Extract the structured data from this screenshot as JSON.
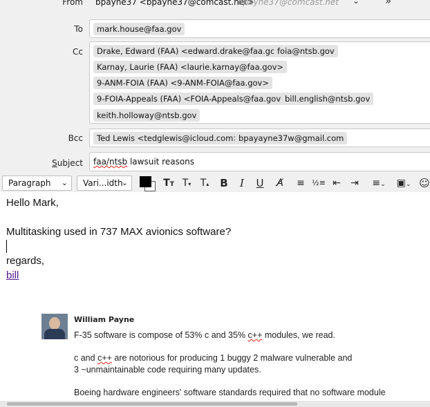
{
  "header": {
    "from_label": "From",
    "from_value": "bpayne37 <bpayne37@comcast.net>",
    "from_hint": "bpayne37@comcast.net",
    "to_label": "To",
    "to": [
      "mark.house@faa.gov"
    ],
    "cc_label": "Cc",
    "cc": [
      "Drake, Edward (FAA) <edward.drake@faa.gov>",
      "foia@ntsb.gov",
      "Karnay, Laurie (FAA) <laurie.karnay@faa.gov>",
      "9-ANM-FOIA (FAA) <9-ANM-FOIA@faa.gov>",
      "9-FOIA-Appeals (FAA) <FOIA-Appeals@faa.gov>",
      "bill.english@ntsb.gov",
      "keith.holloway@ntsb.gov"
    ],
    "bcc_label": "Bcc",
    "bcc": [
      "Ted Lewis <tedglewis@icloud.com>",
      "bpayayne37w@gmail.com"
    ],
    "subject_label": "Subject",
    "subject_value": "faa/ntsb lawsuit reasons"
  },
  "toolbar": {
    "paragraph_format": "Paragraph",
    "font_select": "Vari...idth",
    "text_color": "#000000",
    "bg_color": "#ffffff",
    "icons": [
      "font-size-decrease-icon",
      "font-size-small-icon",
      "font-size-increase-icon",
      "bold-icon",
      "italic-icon",
      "underline-icon",
      "clear-format-icon",
      "bulleted-list-icon",
      "numbered-list-icon",
      "outdent-icon",
      "indent-icon",
      "align-icon",
      "insert-image-icon",
      "emoji-icon"
    ]
  },
  "body": {
    "greeting": "Hello Mark,",
    "line1": "Multitasking used in 737 MAX avionics software?",
    "closing": "regards,",
    "signature": "bill",
    "quoted": {
      "author": "William Payne",
      "p1": "F-35 software is compose of 53% c and 35% c++ modules, we read.",
      "p2a": "c and c++ are notorious for producing 1 buggy 2 malware vulnerable and",
      "p2b": "3 ~unmaintainable code requiring many updates.",
      "p3": "Boeing hardware engineers' software standards required that no software module"
    }
  }
}
